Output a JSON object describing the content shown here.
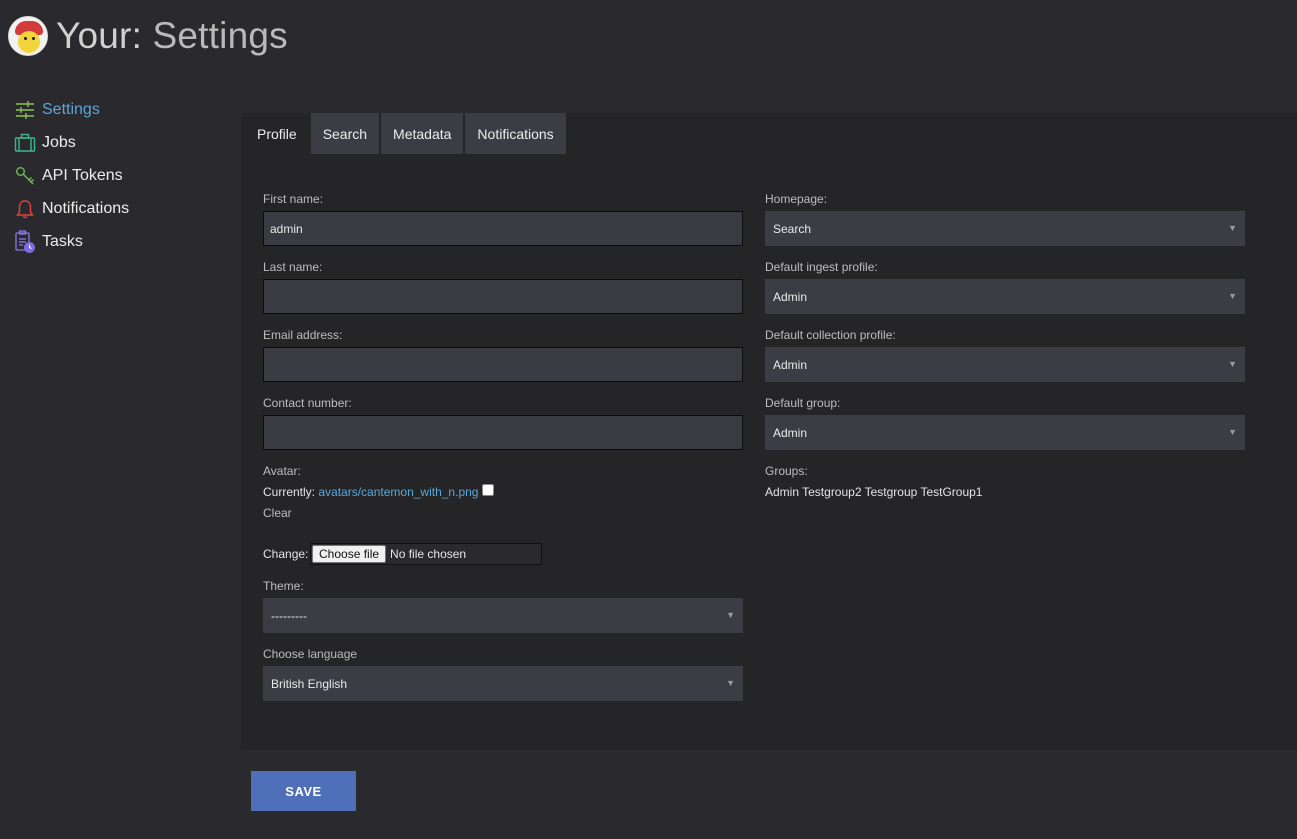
{
  "header": {
    "brand": "Your",
    "separator": ":",
    "section": " Settings"
  },
  "sidebar": {
    "items": [
      {
        "label": "Settings",
        "icon": "sliders-icon"
      },
      {
        "label": "Jobs",
        "icon": "briefcase-icon"
      },
      {
        "label": "API Tokens",
        "icon": "key-icon"
      },
      {
        "label": "Notifications",
        "icon": "bell-icon"
      },
      {
        "label": "Tasks",
        "icon": "clipboard-clock-icon"
      }
    ]
  },
  "tabs": [
    "Profile",
    "Search",
    "Metadata",
    "Notifications"
  ],
  "profile": {
    "first_name_label": "First name:",
    "first_name_value": "admin",
    "last_name_label": "Last name:",
    "last_name_value": "",
    "email_label": "Email address:",
    "email_value": "",
    "contact_label": "Contact number:",
    "contact_value": "",
    "avatar_label": "Avatar:",
    "currently_label": "Currently:",
    "avatar_file": "avatars/cantemon_with_n.png",
    "clear_label": "Clear",
    "change_label": "Change:",
    "choose_file_label": "Choose file",
    "no_file_label": "No file chosen",
    "theme_label": "Theme:",
    "theme_value": "---------",
    "language_label": "Choose language",
    "language_value": "British English"
  },
  "right": {
    "homepage_label": "Homepage:",
    "homepage_value": "Search",
    "ingest_label": "Default ingest profile:",
    "ingest_value": "Admin",
    "collection_label": "Default collection profile:",
    "collection_value": "Admin",
    "group_label": "Default group:",
    "group_value": "Admin",
    "groups_label": "Groups:",
    "groups_value": "Admin Testgroup2 Testgroup TestGroup1"
  },
  "actions": {
    "save_label": "SAVE"
  },
  "colors": {
    "background": "#2a2a2e",
    "panel": "#252528",
    "accent_link": "#5aa7d8",
    "save_button": "#4f6fb8"
  }
}
